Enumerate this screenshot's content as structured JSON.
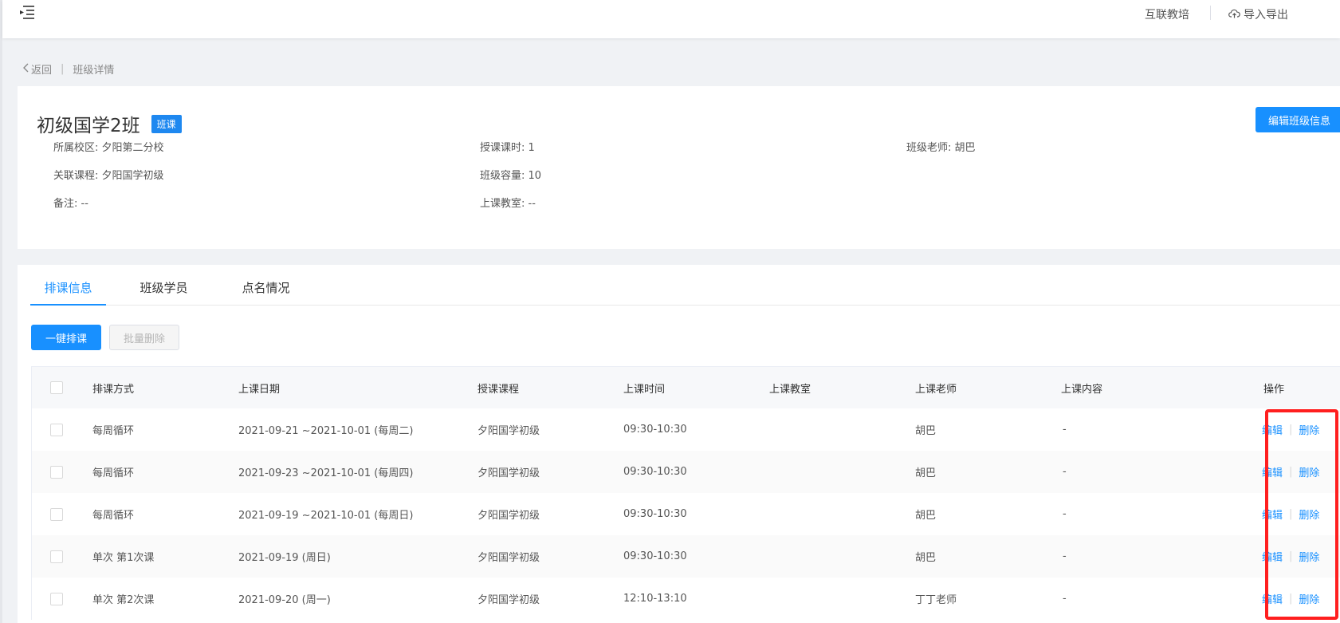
{
  "topbar": {
    "school_name": "互联教培",
    "import_export": "导入导出"
  },
  "breadcrumb": {
    "back": "返回",
    "separator": "|",
    "current": "班级详情"
  },
  "class_info": {
    "title": "初级国学2班",
    "badge": "班课",
    "edit_button": "编辑班级信息",
    "fields": {
      "campus": "所属校区: 夕阳第二分校",
      "hours": "授课课时: 1",
      "teacher": "班级老师:  胡巴",
      "course": "关联课程: 夕阳国学初级",
      "capacity": "班级容量: 10",
      "note": "备注: --",
      "classroom": "上课教室: --"
    }
  },
  "tabs": [
    {
      "label": "排课信息",
      "active": true
    },
    {
      "label": "班级学员",
      "active": false
    },
    {
      "label": "点名情况",
      "active": false
    }
  ],
  "toolbar": {
    "schedule_button": "一键排课",
    "batch_delete_button": "批量删除"
  },
  "table": {
    "headers": {
      "method": "排课方式",
      "date": "上课日期",
      "course": "授课课程",
      "time": "上课时间",
      "room": "上课教室",
      "teacher": "上课老师",
      "content": "上课内容",
      "ops": "操作"
    },
    "edit_label": "编辑",
    "op_separator": "|",
    "delete_label": "删除",
    "rows": [
      {
        "method": "每周循环",
        "date": "2021-09-21 ~2021-10-01 (每周二)",
        "course": "夕阳国学初级",
        "time": "09:30-10:30",
        "room": "",
        "teacher": "胡巴",
        "content": "-"
      },
      {
        "method": "每周循环",
        "date": "2021-09-23 ~2021-10-01 (每周四)",
        "course": "夕阳国学初级",
        "time": "09:30-10:30",
        "room": "",
        "teacher": "胡巴",
        "content": "-"
      },
      {
        "method": "每周循环",
        "date": "2021-09-19 ~2021-10-01 (每周日)",
        "course": "夕阳国学初级",
        "time": "09:30-10:30",
        "room": "",
        "teacher": "胡巴",
        "content": "-"
      },
      {
        "method": "单次 第1次课",
        "date": "2021-09-19 (周日)",
        "course": "夕阳国学初级",
        "time": "09:30-10:30",
        "room": "",
        "teacher": "胡巴",
        "content": "-"
      },
      {
        "method": "单次 第2次课",
        "date": "2021-09-20 (周一)",
        "course": "夕阳国学初级",
        "time": "12:10-13:10",
        "room": "",
        "teacher": "丁丁老师",
        "content": "-"
      }
    ]
  },
  "colors": {
    "primary": "#1890ff",
    "highlight": "#ff1f1f"
  }
}
